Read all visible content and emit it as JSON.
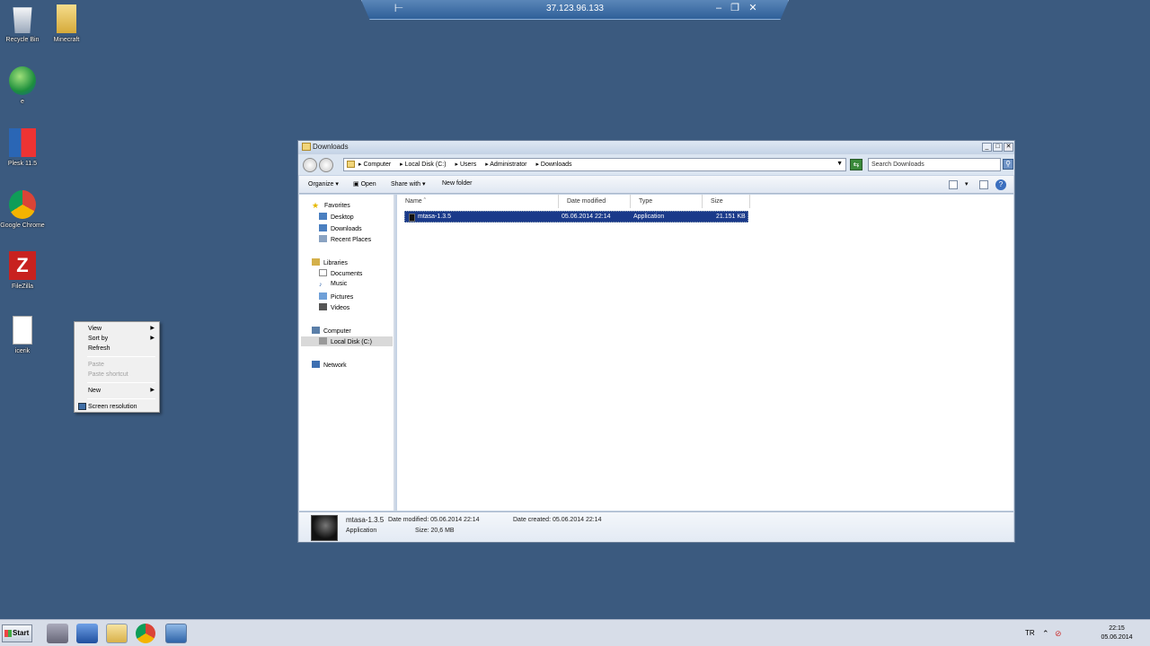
{
  "rdp": {
    "host": "37.123.96.133"
  },
  "desktop_icons": [
    {
      "label": "Recycle Bin",
      "icon": "recycle-bin-icon"
    },
    {
      "label": "Minecraft",
      "icon": "folder-icon"
    },
    {
      "label": "e",
      "icon": "internet-download-icon"
    },
    {
      "label": "Plesk 11.5",
      "icon": "plesk-icon"
    },
    {
      "label": "Google Chrome",
      "icon": "chrome-icon"
    },
    {
      "label": "FileZilla",
      "icon": "filezilla-icon"
    },
    {
      "label": "icerik",
      "icon": "text-file-icon"
    }
  ],
  "context_menu": {
    "items": [
      {
        "label": "View",
        "submenu": true,
        "enabled": true
      },
      {
        "label": "Sort by",
        "submenu": true,
        "enabled": true
      },
      {
        "label": "Refresh",
        "submenu": false,
        "enabled": true
      },
      {
        "label": "Paste",
        "submenu": false,
        "enabled": false
      },
      {
        "label": "Paste shortcut",
        "submenu": false,
        "enabled": false
      },
      {
        "label": "New",
        "submenu": true,
        "enabled": true
      },
      {
        "label": "Screen resolution",
        "submenu": false,
        "enabled": true
      }
    ]
  },
  "explorer": {
    "title": "Downloads",
    "breadcrumb": [
      "Computer",
      "Local Disk (C:)",
      "Users",
      "Administrator",
      "Downloads"
    ],
    "search_placeholder": "Search Downloads",
    "toolbar": {
      "organize": "Organize",
      "open": "Open",
      "share_with": "Share with",
      "new_folder": "New folder"
    },
    "nav": {
      "favorites": "Favorites",
      "desktop": "Desktop",
      "downloads": "Downloads",
      "recent_places": "Recent Places",
      "libraries": "Libraries",
      "documents": "Documents",
      "music": "Music",
      "pictures": "Pictures",
      "videos": "Videos",
      "computer": "Computer",
      "local_disk": "Local Disk (C:)",
      "network": "Network"
    },
    "columns": {
      "name": "Name",
      "date_modified": "Date modified",
      "type": "Type",
      "size": "Size"
    },
    "files": [
      {
        "name": "mtasa-1.3.5",
        "date_modified": "05.06.2014 22:14",
        "type": "Application",
        "size": "21.151 KB"
      }
    ],
    "details": {
      "name": "mtasa-1.3.5",
      "date_modified": "Date modified: 05.06.2014 22:14",
      "date_created": "Date created: 05.06.2014 22:14",
      "type": "Application",
      "size": "Size: 20,6 MB"
    }
  },
  "taskbar": {
    "start": "Start",
    "lang": "TR",
    "time": "22:15",
    "date": "05.06.2014"
  }
}
